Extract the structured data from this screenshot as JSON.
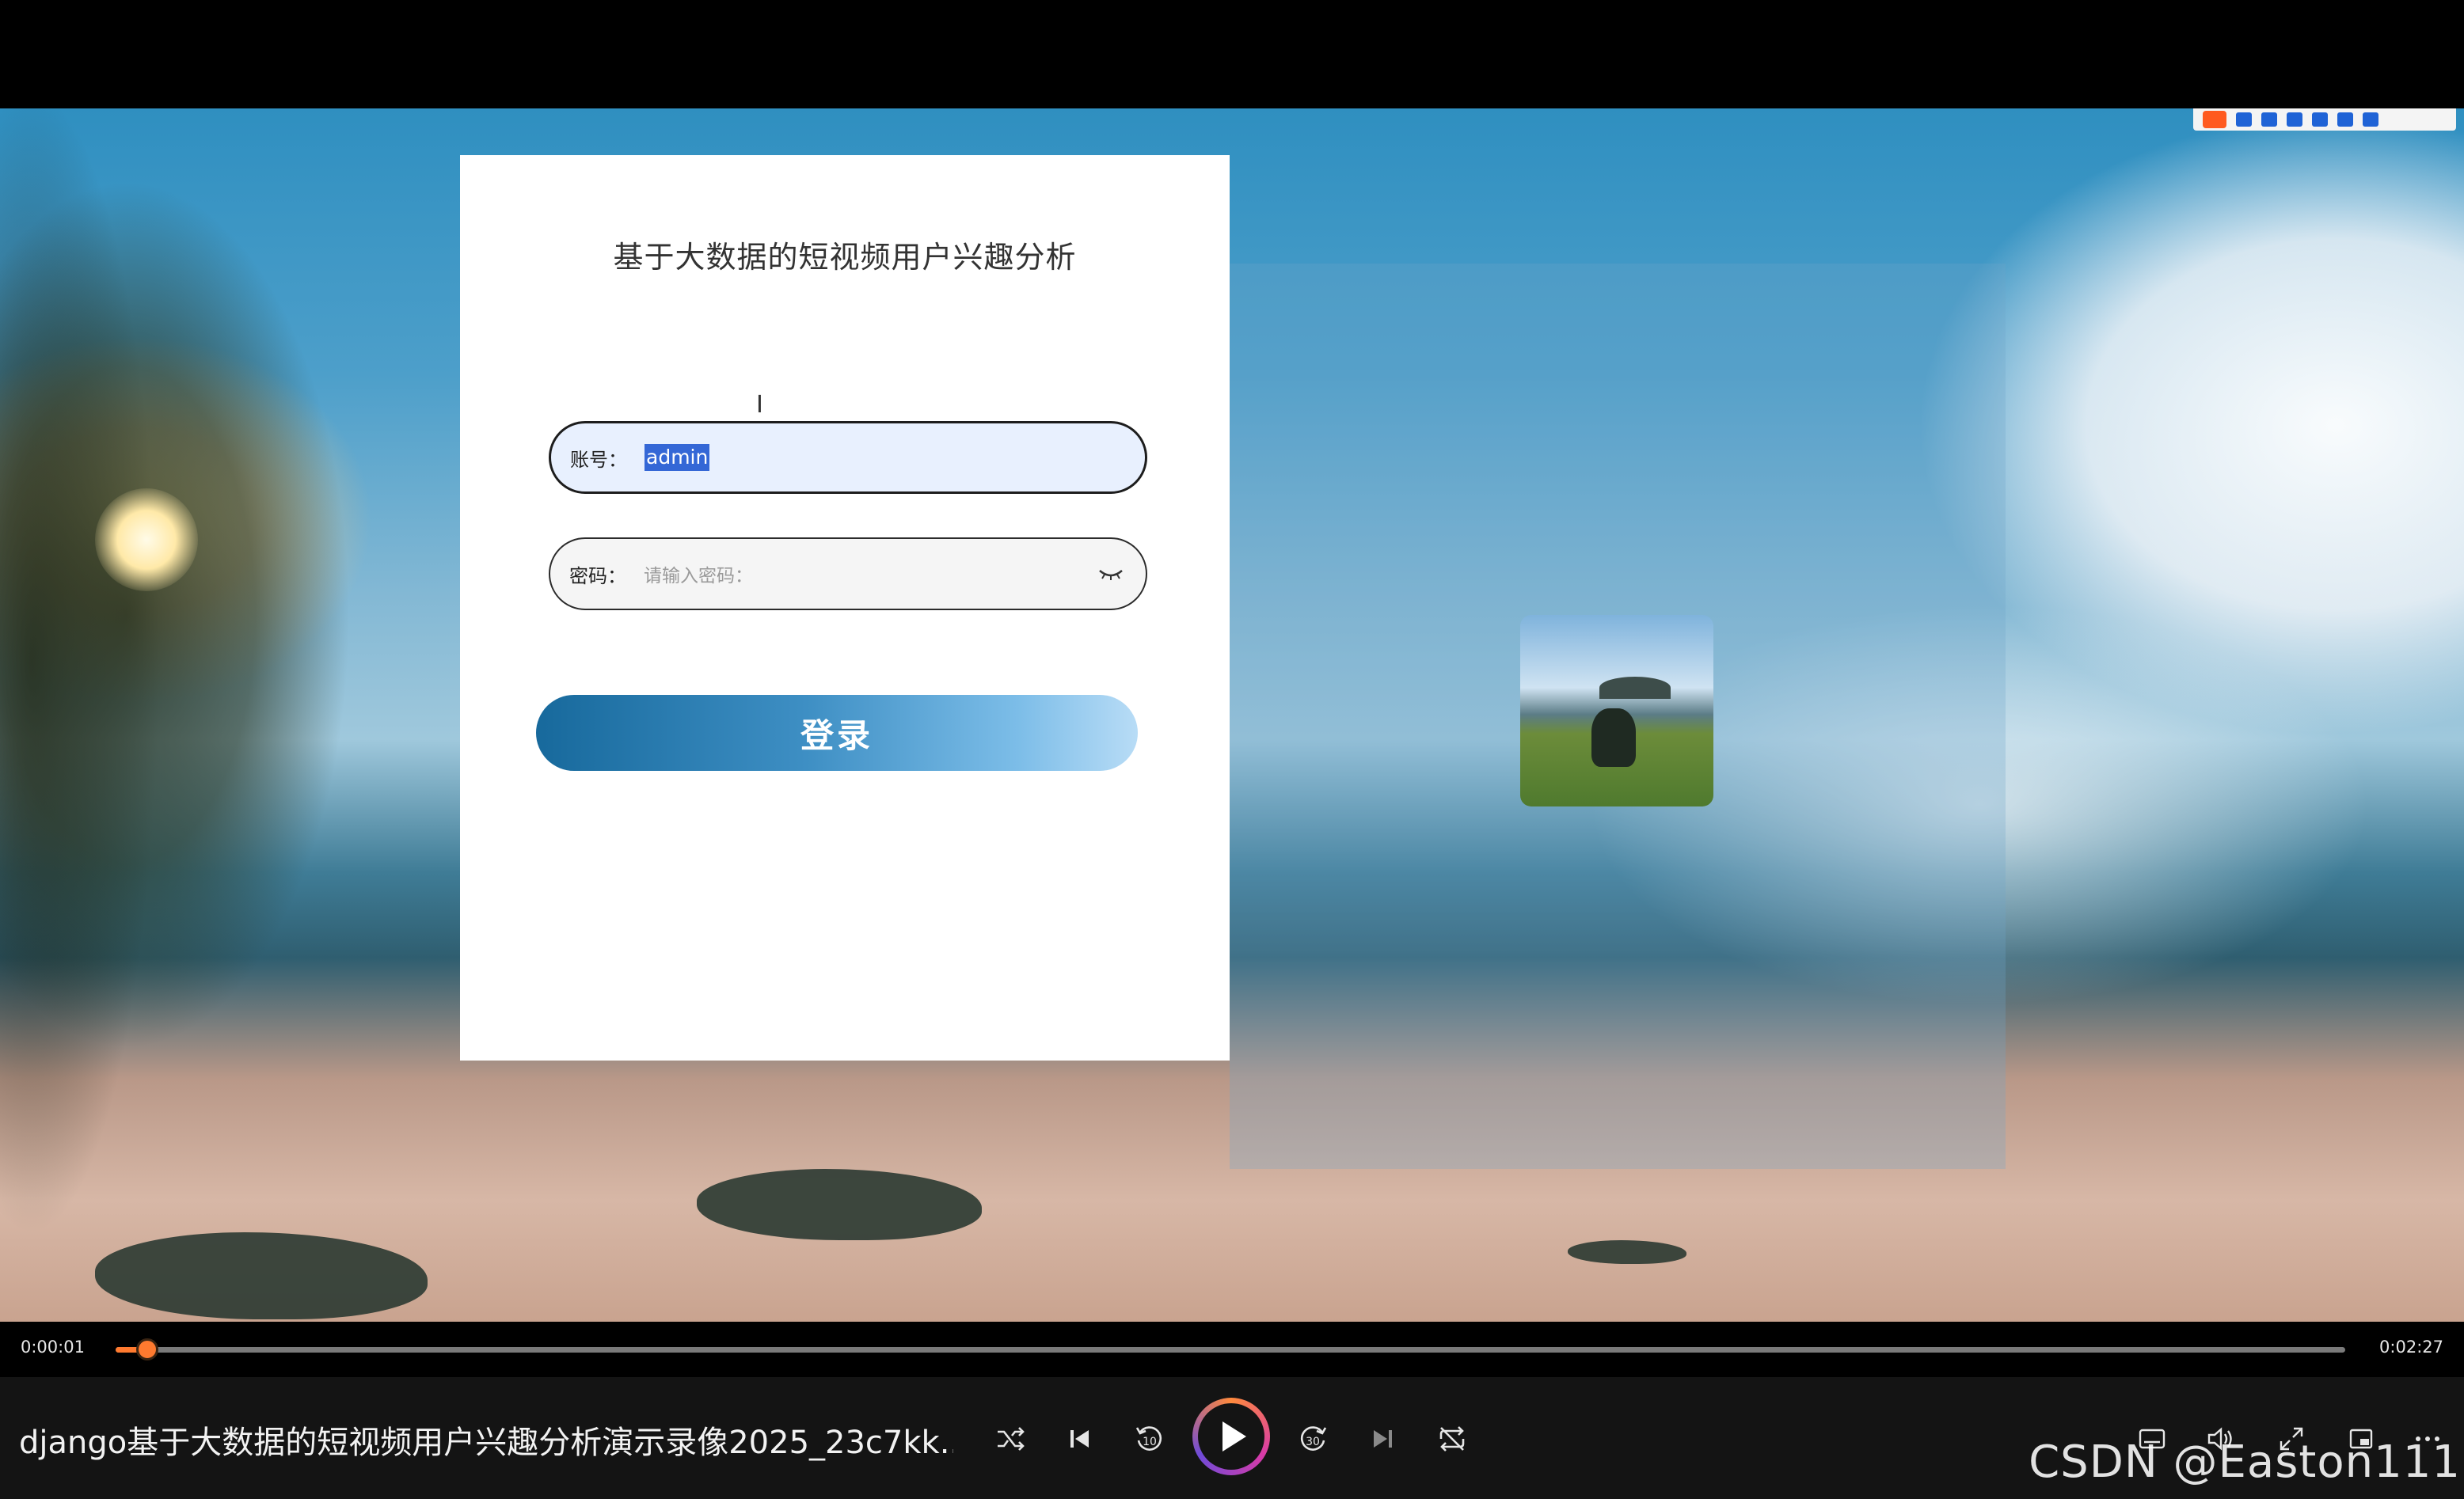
{
  "login": {
    "title": "基于大数据的短视频用户兴趣分析",
    "account_label": "账号：",
    "account_value": "admin",
    "password_label": "密码：",
    "password_placeholder": "请输入密码：",
    "submit_label": "登录"
  },
  "player": {
    "current_time": "0:00:01",
    "total_time": "0:02:27",
    "progress_fraction": 0.007,
    "video_title": "django基于大数据的短视频用户兴趣分析演示录像2025_23c7kk...",
    "rewind_seconds": "10",
    "forward_seconds": "30",
    "icons": [
      "shuffle-icon",
      "previous-icon",
      "rewind-10-icon",
      "play-icon",
      "forward-30-icon",
      "next-icon",
      "repeat-off-icon",
      "subtitles-icon",
      "volume-icon",
      "fullscreen-icon",
      "mini-player-icon",
      "more-icon"
    ],
    "accent_color": "#ff7a2f"
  },
  "watermark": "CSDN @Easton111"
}
